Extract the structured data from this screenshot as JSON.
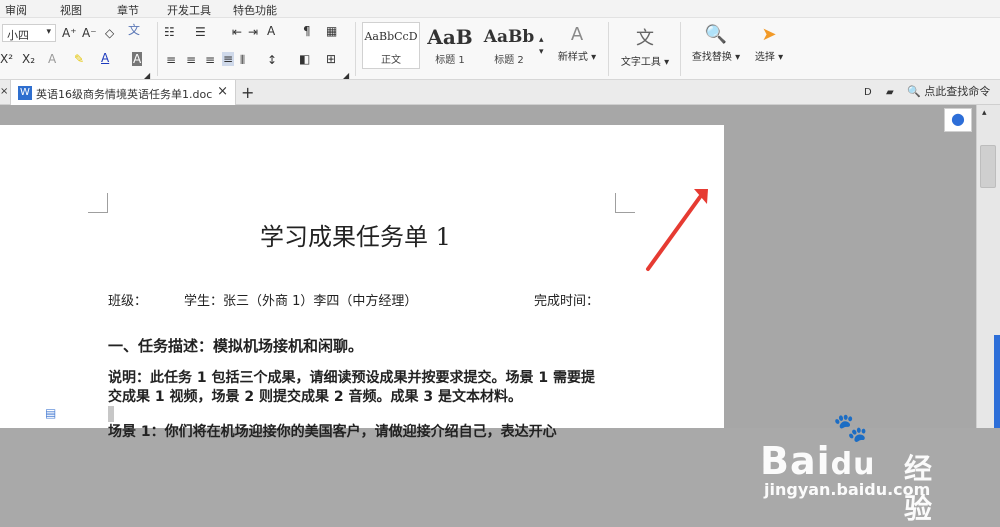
{
  "menu": {
    "items": [
      "审阅",
      "视图",
      "章节",
      "开发工具",
      "特色功能"
    ]
  },
  "ribbon": {
    "font_size": "小四",
    "styles": [
      {
        "preview": "AaBbCcD",
        "name": "正文"
      },
      {
        "preview": "AaB",
        "name": "标题 1"
      },
      {
        "preview": "AaBb",
        "name": "标题 2"
      }
    ],
    "buttons": {
      "new_style": "新样式",
      "text_tools": "文字工具",
      "find_replace": "查找替换",
      "select": "选择"
    }
  },
  "tabbar": {
    "document_tab": "英语16级商务情境英语任务单1.doc",
    "search_hint": "点此查找命令"
  },
  "document": {
    "title": "学习成果任务单 1",
    "class_label": "班级：",
    "student_label": "学生：张三（外商 1）李四（中方经理）",
    "finish_time_label": "完成时间：",
    "section_heading": "一、任务描述：模拟机场接机和闲聊。",
    "description_line_1": "说明：此任务 1 包括三个成果，请细读预设成果并按要求提交。场景 1 需要提",
    "description_line_2": "交成果 1 视频，场景 2 则提交成果 2 音频。成果 3 是文本材料。",
    "partial_line": "场景 1：你们将在机场迎接你的美国客户，请做迎接介绍自己，表达开心"
  },
  "watermark": {
    "brand": "Bai",
    "brand_suffix": "du",
    "chinese": "经验",
    "url": "jingyan.baidu.com"
  },
  "colors": {
    "page_background": "#a7a7a7",
    "accent_blue": "#2d6ed8",
    "annotation_red": "#e63b32"
  }
}
